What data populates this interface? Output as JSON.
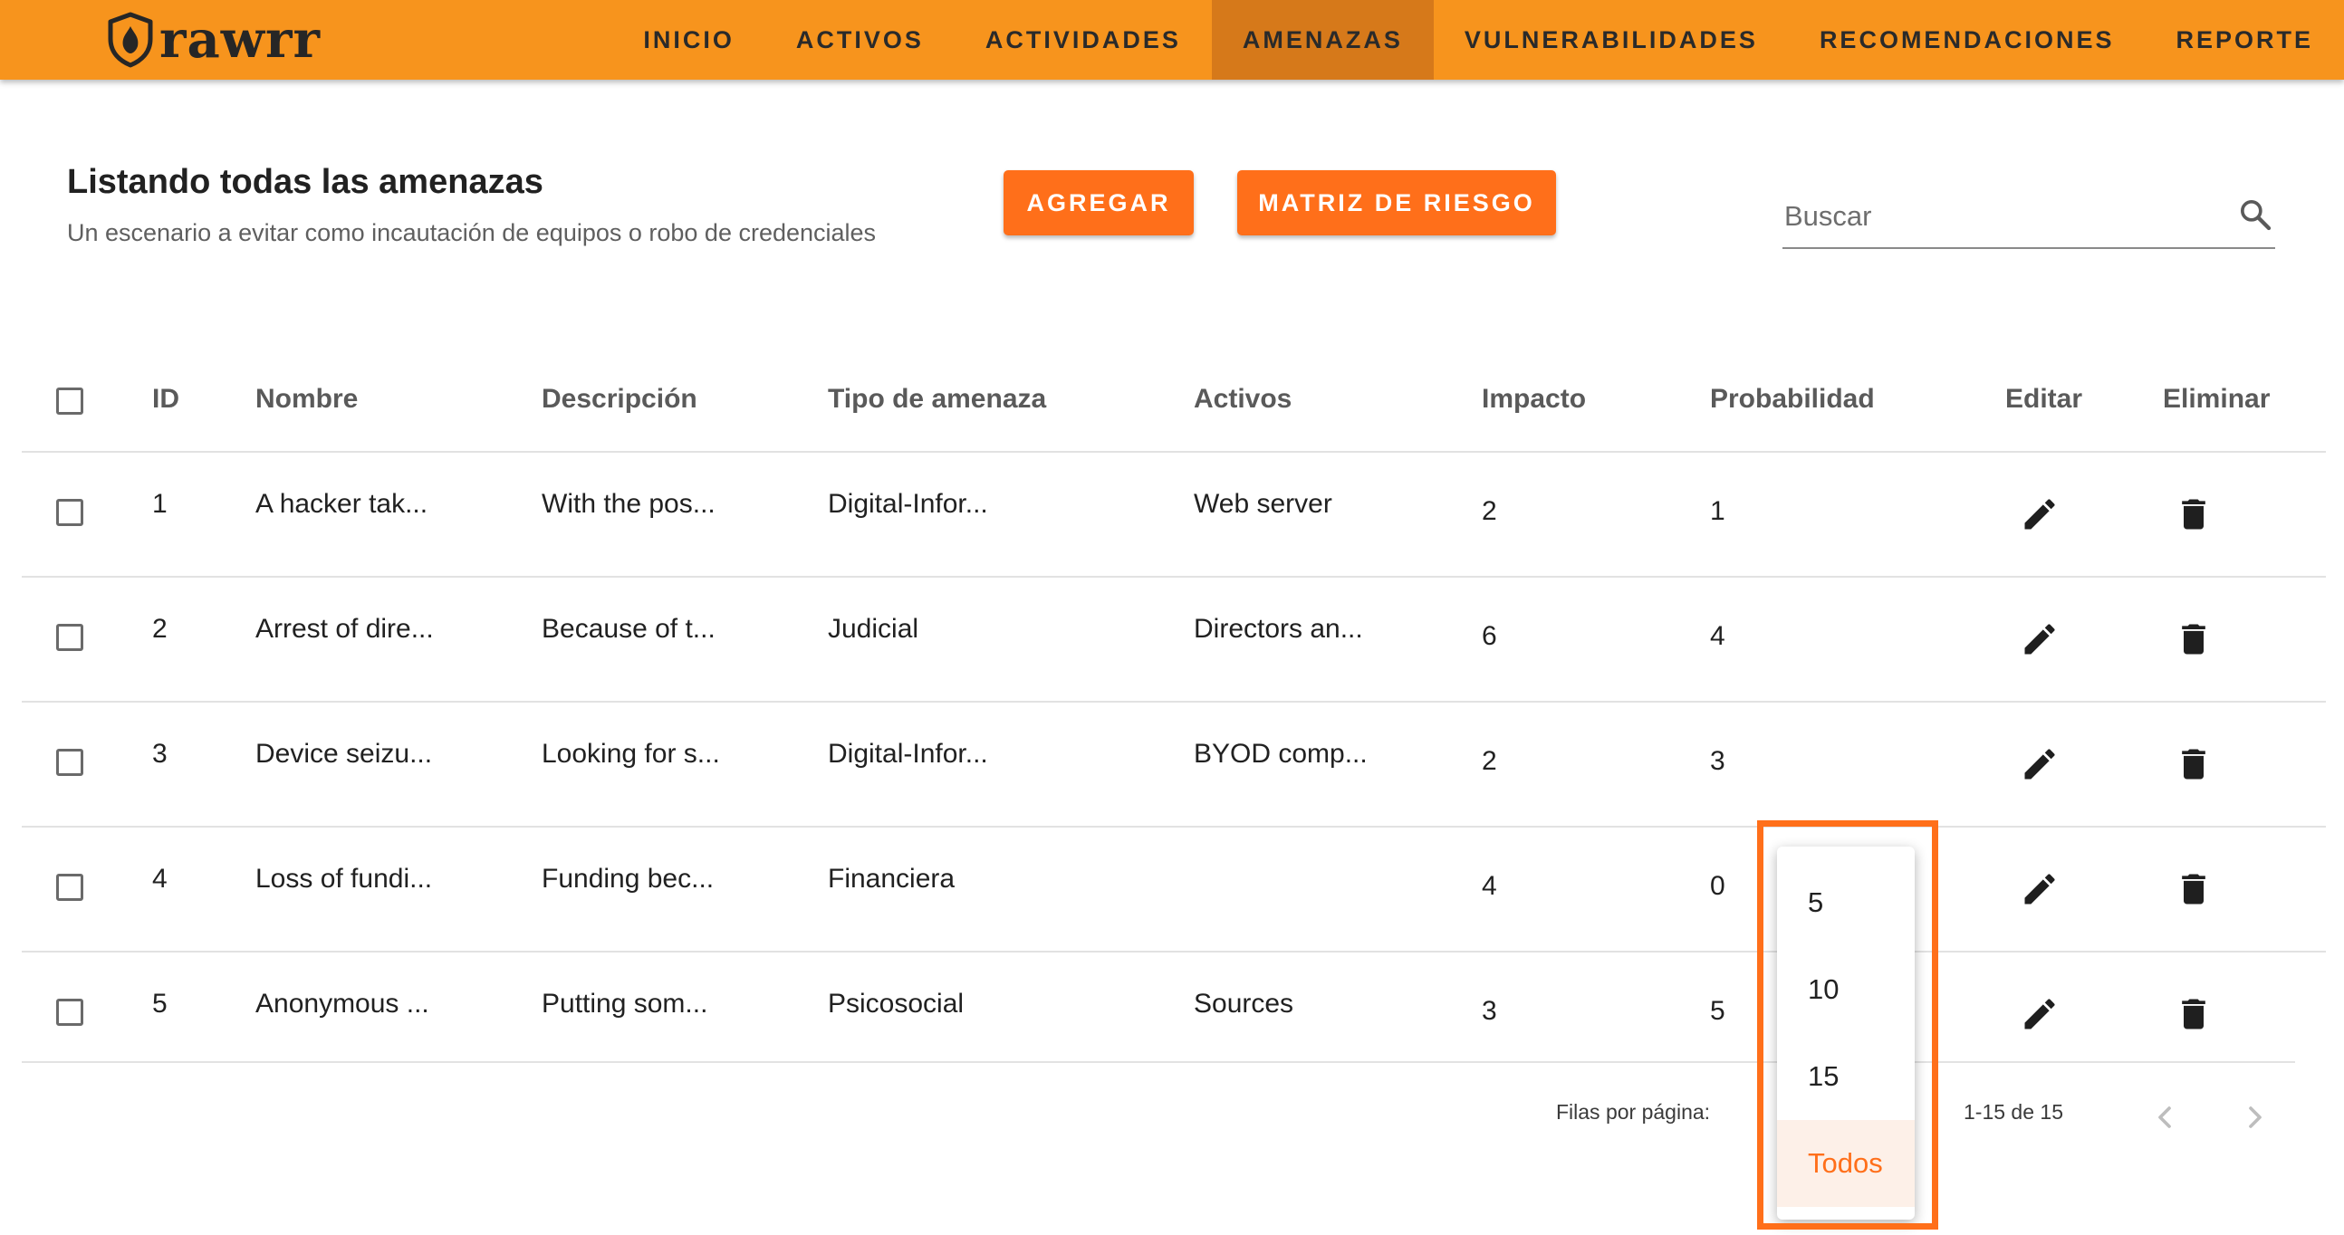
{
  "app": {
    "logo_text": "rawrr"
  },
  "nav": {
    "items": [
      {
        "label": "INICIO"
      },
      {
        "label": "ACTIVOS"
      },
      {
        "label": "ACTIVIDADES"
      },
      {
        "label": "AMENAZAS",
        "active": true
      },
      {
        "label": "VULNERABILIDADES"
      },
      {
        "label": "RECOMENDACIONES"
      },
      {
        "label": "REPORTE"
      }
    ]
  },
  "page": {
    "title": "Listando todas las amenazas",
    "subtitle": "Un escenario a evitar como incautación de equipos o robo de credenciales",
    "add_button": "AGREGAR",
    "matrix_button": "MATRIZ DE RIESGO"
  },
  "search": {
    "placeholder": "Buscar",
    "icon": "search-icon"
  },
  "table": {
    "headers": [
      "ID",
      "Nombre",
      "Descripción",
      "Tipo de amenaza",
      "Activos",
      "Impacto",
      "Probabilidad",
      "Editar",
      "Eliminar"
    ],
    "rows": [
      {
        "id": "1",
        "name": "A hacker tak...",
        "description": "With the pos...",
        "type": "Digital-Infor...",
        "assets": "Web server",
        "impact": "2",
        "probability": "1"
      },
      {
        "id": "2",
        "name": "Arrest of dire...",
        "description": "Because of t...",
        "type": "Judicial",
        "assets": "Directors an...",
        "impact": "6",
        "probability": "4"
      },
      {
        "id": "3",
        "name": "Device seizu...",
        "description": "Looking for s...",
        "type": "Digital-Infor...",
        "assets": "BYOD comp...",
        "impact": "2",
        "probability": "3"
      },
      {
        "id": "4",
        "name": "Loss of fundi...",
        "description": "Funding bec...",
        "type": "Financiera",
        "assets": "",
        "impact": "4",
        "probability": "0"
      },
      {
        "id": "5",
        "name": "Anonymous ...",
        "description": "Putting som...",
        "type": "Psicosocial",
        "assets": "Sources",
        "impact": "3",
        "probability": "5"
      }
    ]
  },
  "pagination": {
    "rows_per_page_label": "Filas por página:",
    "range": "1-15 de 15",
    "options": [
      "5",
      "10",
      "15",
      "Todos"
    ],
    "selected": "Todos"
  },
  "colors": {
    "topbar": "#f7941d",
    "accent": "#ff6f1a",
    "active_nav": "#d6791a"
  }
}
